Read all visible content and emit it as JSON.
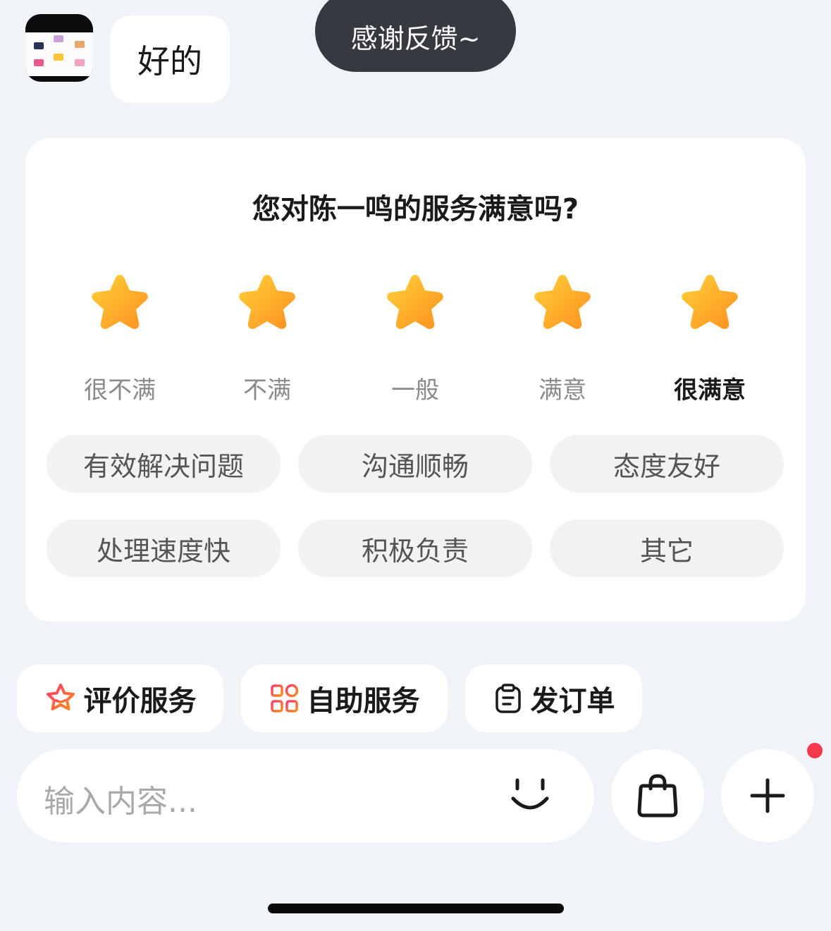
{
  "chat": {
    "reply_text": "好的"
  },
  "toast": {
    "text": "感谢反馈~"
  },
  "rating_card": {
    "title": "您对陈一鸣的服务满意吗?",
    "rating_value": 5,
    "rating_max": 5,
    "star_color": "#ffa51f",
    "levels": [
      {
        "label": "很不满"
      },
      {
        "label": "不满"
      },
      {
        "label": "一般"
      },
      {
        "label": "满意"
      },
      {
        "label": "很满意"
      }
    ],
    "tags": [
      {
        "label": "有效解决问题"
      },
      {
        "label": "沟通顺畅"
      },
      {
        "label": "态度友好"
      },
      {
        "label": "处理速度快"
      },
      {
        "label": "积极负责"
      },
      {
        "label": "其它"
      }
    ]
  },
  "quick_actions": [
    {
      "label": "评价服务",
      "icon": "star-outline-icon"
    },
    {
      "label": "自助服务",
      "icon": "apps-icon"
    },
    {
      "label": "发订单",
      "icon": "clipboard-icon"
    }
  ],
  "input": {
    "placeholder": "输入内容..."
  },
  "icons": {
    "emoji": "smile-icon",
    "shop": "shopping-bag-icon",
    "add": "plus-icon"
  },
  "colors": {
    "accent_gradient_start": "#ff3a6e",
    "accent_gradient_end": "#ff8a1a",
    "notification_dot": "#f4394c"
  }
}
